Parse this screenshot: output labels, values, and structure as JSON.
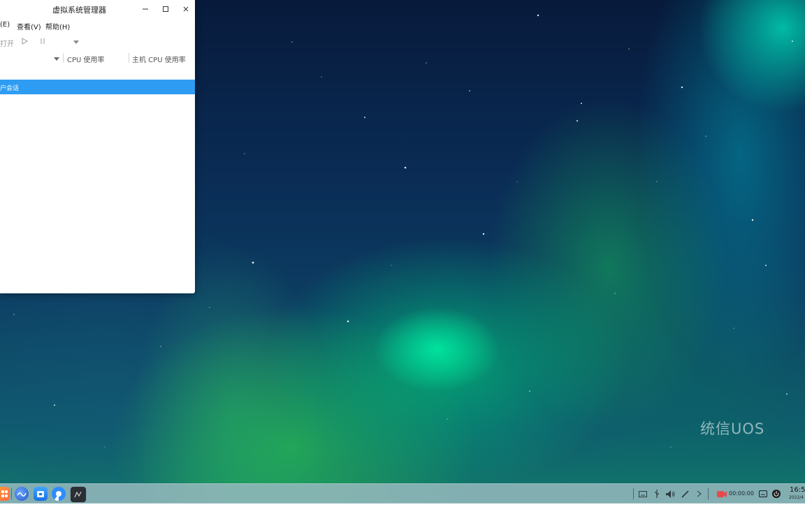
{
  "window": {
    "title": "虚拟系统管理器",
    "menu": [
      "(E)",
      "查看(V)",
      "帮助(H)"
    ],
    "toolbar": {
      "open_label": "打开"
    },
    "columns": [
      "CPU 使用率",
      "主机 CPU 使用率"
    ],
    "rows": [
      {
        "label": "户会话",
        "selected": true
      }
    ]
  },
  "desktop": {
    "watermark": "统信UOS"
  },
  "taskbar": {
    "dock": [
      "launcher-icon",
      "deepin-icon",
      "app-store-icon",
      "browser-icon",
      "virt-manager-icon"
    ],
    "tray": [
      "keyboard-icon",
      "usb-icon",
      "volume-icon",
      "pen-icon",
      "chevron-right-icon",
      "record-icon",
      "notification-icon",
      "power-icon"
    ],
    "record_timer": "00:00:00",
    "clock_time": "16:5",
    "clock_date": "2022/4"
  },
  "colors": {
    "selection": "#2e9cf2",
    "taskbar": "#96b9be"
  }
}
